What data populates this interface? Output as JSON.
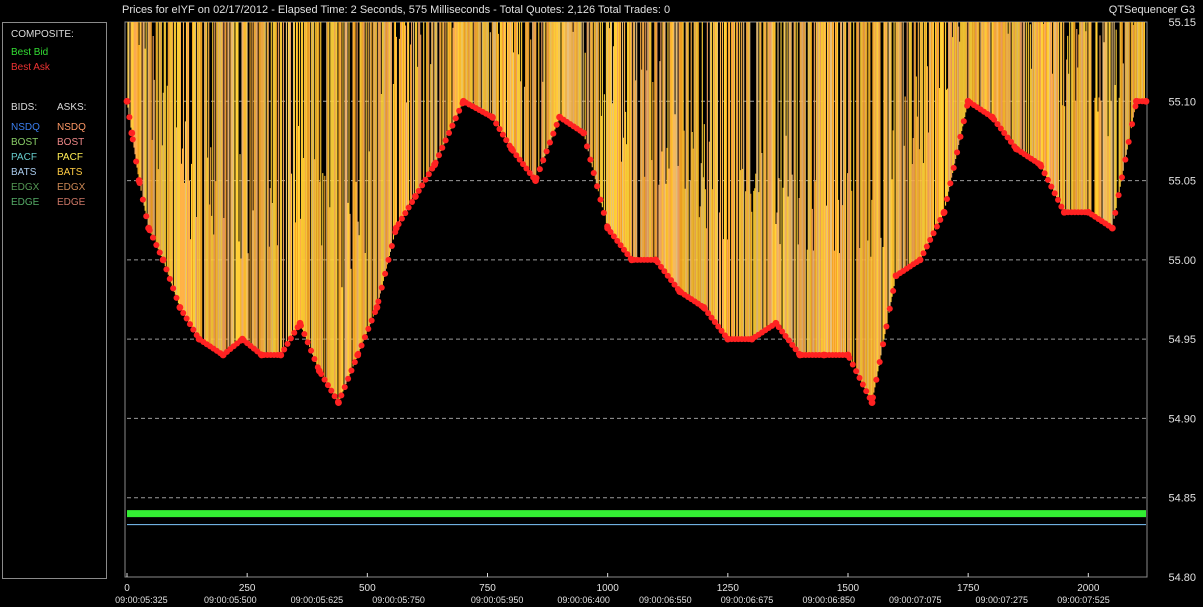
{
  "header": {
    "title": "Prices for  eIYF  on  02/17/2012  -  Elapsed Time: 2 Seconds, 575 Milliseconds  -  Total Quotes: 2,126  Total Trades: 0",
    "app_name": "QTSequencer G3"
  },
  "legend": {
    "composite_label": "COMPOSITE:",
    "best_bid": {
      "label": "Best Bid",
      "color": "#33dd33"
    },
    "best_ask": {
      "label": "Best Ask",
      "color": "#ee3333"
    },
    "bids_label": "BIDS:",
    "asks_label": "ASKS:",
    "bids": [
      {
        "label": "NSDQ",
        "color": "#3b7ff0"
      },
      {
        "label": "BOST",
        "color": "#88cc66"
      },
      {
        "label": "PACF",
        "color": "#66cccc"
      },
      {
        "label": "BATS",
        "color": "#aaccee"
      },
      {
        "label": "EDGX",
        "color": "#559955"
      },
      {
        "label": "EDGE",
        "color": "#55aa66"
      }
    ],
    "asks": [
      {
        "label": "NSDQ",
        "color": "#ff9966"
      },
      {
        "label": "BOST",
        "color": "#ee8888"
      },
      {
        "label": "PACF",
        "color": "#ffee55"
      },
      {
        "label": "BATS",
        "color": "#ffcc44"
      },
      {
        "label": "EDGX",
        "color": "#cc8855"
      },
      {
        "label": "EDGE",
        "color": "#cc7766"
      }
    ]
  },
  "chart_data": {
    "type": "line",
    "title": "",
    "xlabel": "",
    "ylabel": "",
    "xlim": [
      0,
      2120
    ],
    "ylim": [
      54.8,
      55.15
    ],
    "x_ticks": [
      0,
      250,
      500,
      750,
      1000,
      1250,
      1500,
      1750,
      2000
    ],
    "y_ticks": [
      "55.15",
      "55.10",
      "55.05",
      "55.00",
      "54.95",
      "54.90",
      "54.85",
      "54.80"
    ],
    "time_labels": [
      {
        "x": 30,
        "label": "09:00:05:325"
      },
      {
        "x": 215,
        "label": "09:00:05:500"
      },
      {
        "x": 395,
        "label": "09:00:05:625"
      },
      {
        "x": 565,
        "label": "09:00:05:750"
      },
      {
        "x": 770,
        "label": "09:00:05:950"
      },
      {
        "x": 950,
        "label": "09:00:06:400"
      },
      {
        "x": 1120,
        "label": "09:00:06:550"
      },
      {
        "x": 1290,
        "label": "09:00:06:675"
      },
      {
        "x": 1460,
        "label": "09:00:06:850"
      },
      {
        "x": 1640,
        "label": "09:00:07:075"
      },
      {
        "x": 1820,
        "label": "09:00:07:275"
      },
      {
        "x": 1990,
        "label": "09:00:07:525"
      }
    ],
    "grid": true,
    "series": [
      {
        "name": "Best Bid",
        "color": "#33ee33",
        "x": [
          0,
          2120
        ],
        "y": [
          54.84,
          54.84
        ]
      },
      {
        "name": "Best Ask",
        "color": "#ff2222",
        "x": [
          0,
          10,
          25,
          45,
          75,
          110,
          150,
          200,
          240,
          280,
          320,
          360,
          400,
          440,
          480,
          520,
          560,
          600,
          640,
          700,
          760,
          800,
          850,
          900,
          950,
          1000,
          1050,
          1100,
          1150,
          1200,
          1250,
          1300,
          1350,
          1400,
          1450,
          1500,
          1550,
          1600,
          1650,
          1700,
          1750,
          1800,
          1850,
          1900,
          1950,
          2000,
          2050,
          2100,
          2120
        ],
        "y": [
          55.1,
          55.08,
          55.05,
          55.02,
          55.0,
          54.97,
          54.95,
          54.94,
          54.95,
          54.94,
          54.94,
          54.96,
          54.93,
          54.91,
          54.94,
          54.97,
          55.02,
          55.04,
          55.06,
          55.1,
          55.09,
          55.07,
          55.05,
          55.09,
          55.08,
          55.02,
          55.0,
          55.0,
          54.98,
          54.97,
          54.95,
          54.95,
          54.96,
          54.94,
          54.94,
          54.94,
          54.91,
          54.99,
          55.0,
          55.03,
          55.1,
          55.09,
          55.07,
          55.06,
          55.03,
          55.03,
          55.02,
          55.1,
          55.1
        ]
      }
    ]
  }
}
